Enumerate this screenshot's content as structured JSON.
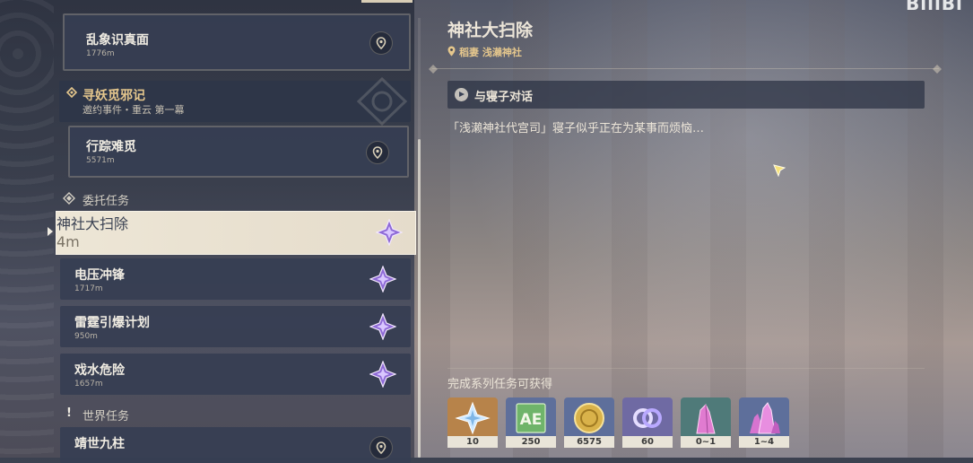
{
  "quest_list": {
    "items": [
      {
        "title": "乱象识真面",
        "distance": "1776m"
      },
      {
        "title": "行踪难觅",
        "distance": "5571m"
      }
    ],
    "event_quest": {
      "title": "寻妖觅邪记",
      "subtitle": "邀约事件・重云 第一幕"
    },
    "commission_section": "委托任务",
    "commissions": [
      {
        "title": "神社大扫除",
        "distance": "4m"
      },
      {
        "title": "电压冲锋",
        "distance": "1717m"
      },
      {
        "title": "雷霆引爆计划",
        "distance": "950m"
      },
      {
        "title": "戏水危险",
        "distance": "1657m"
      }
    ],
    "world_section": "世界任务",
    "world_items": [
      {
        "title": "靖世九柱"
      }
    ]
  },
  "detail": {
    "title": "神社大扫除",
    "location": "稻妻 浅濑神社",
    "objective": "与寝子对话",
    "description": "「浅濑神社代宫司」寝子似乎正在为某事而烦恼…",
    "rewards_label": "完成系列任务可获得",
    "rewards": [
      {
        "icon": "primogem-icon",
        "count": "10",
        "bg": "#b7834a"
      },
      {
        "icon": "adventure-exp-icon",
        "count": "250",
        "bg": "#5e6f9b"
      },
      {
        "icon": "mora-icon",
        "count": "6575",
        "bg": "#5e6f9b"
      },
      {
        "icon": "companionship-exp-icon",
        "count": "60",
        "bg": "#6f6aa3"
      },
      {
        "icon": "ore-crystal-icon",
        "count": "0~1",
        "bg": "#4f7a79"
      },
      {
        "icon": "ore-crystal-large-icon",
        "count": "1~4",
        "bg": "#5e6f9b"
      }
    ]
  },
  "brand": "BiliBi"
}
